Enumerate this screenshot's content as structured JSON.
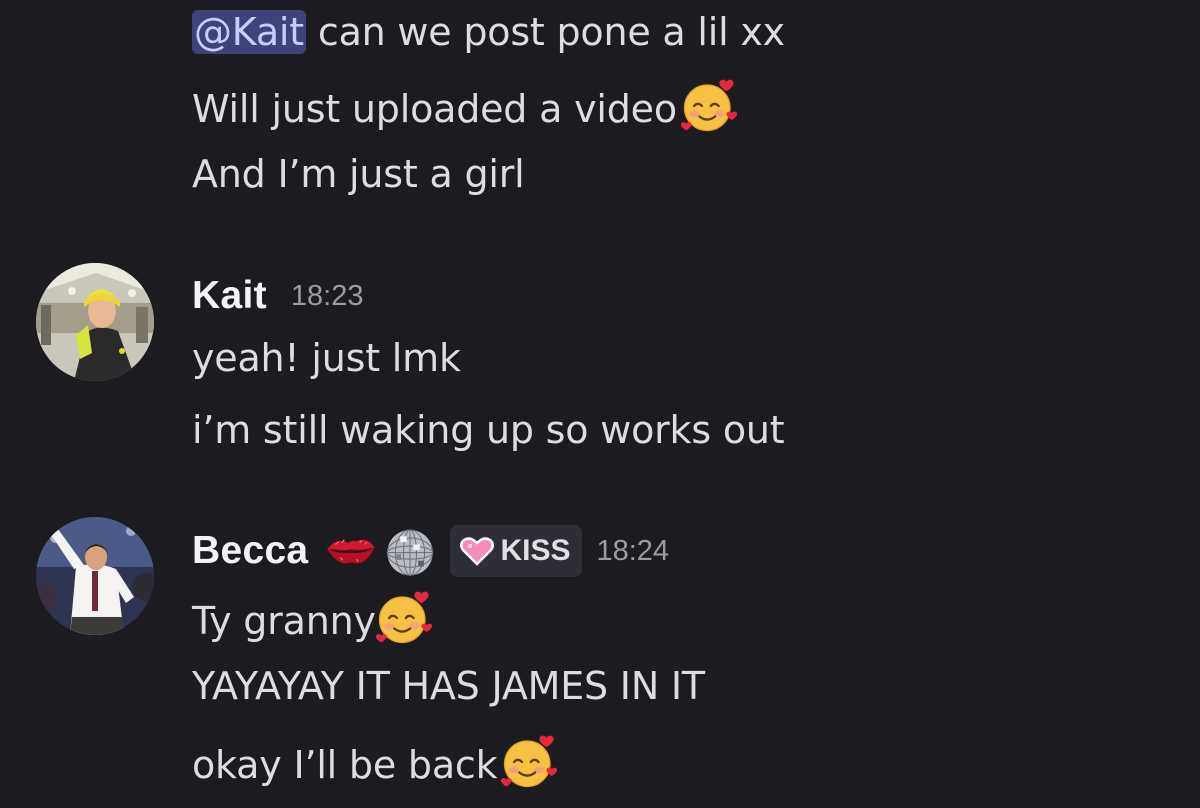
{
  "messages_previous": {
    "mention": "@Kait",
    "line1_text": " can we post pone a lil xx",
    "line2_text": "Will just uploaded a video",
    "line3_text": "And I’m just a girl",
    "emoji": "smiling-face-with-hearts"
  },
  "kait": {
    "username": "Kait",
    "timestamp": "18:23",
    "messages": [
      "yeah! just lmk",
      "i’m still waking up so works out"
    ]
  },
  "becca": {
    "username": "Becca",
    "badges": [
      "kiss-mark-icon",
      "disco-ball-icon"
    ],
    "tag_label": "KISS",
    "tag_icon": "pink-heart-icon",
    "timestamp": "18:24",
    "messages": [
      "Ty granny",
      "YAYAYAY IT HAS JAMES IN IT",
      "okay I’ll be back"
    ]
  },
  "colors": {
    "background": "#1c1c20",
    "mention_bg": "#3d437d",
    "mention_text": "#c9cdfb",
    "username": "#f2f3f5",
    "timestamp": "#9a9ba3"
  }
}
